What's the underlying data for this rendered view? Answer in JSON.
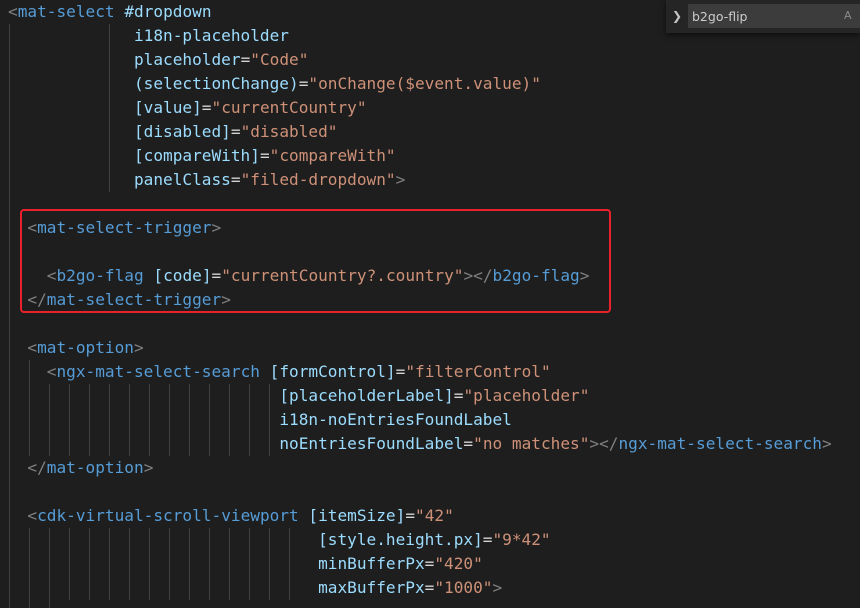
{
  "colors": {
    "background": "#1e1e1e",
    "tag": "#569cd6",
    "punctuation": "#808080",
    "attribute": "#9cdcfe",
    "string": "#ce9178",
    "text": "#d4d4d4",
    "indent_guide": "#404040",
    "highlight_border": "#e8212a"
  },
  "find_widget": {
    "toggle_icon": "chevron-right-icon",
    "value": "b2go-flip",
    "match_case_label": "A"
  },
  "lines": [
    {
      "guides": [],
      "tokens": [
        {
          "t": "<",
          "c": "punc"
        },
        {
          "t": "mat-select",
          "c": "tag"
        },
        {
          "t": " ",
          "c": "plain"
        },
        {
          "t": "#dropdown",
          "c": "attr"
        }
      ]
    },
    {
      "guides": [
        0,
        100
      ],
      "tokens": [
        {
          "t": "             ",
          "c": "plain"
        },
        {
          "t": "i18n-placeholder",
          "c": "attr"
        }
      ]
    },
    {
      "guides": [
        0,
        100
      ],
      "tokens": [
        {
          "t": "             ",
          "c": "plain"
        },
        {
          "t": "placeholder",
          "c": "attr"
        },
        {
          "t": "=",
          "c": "eq"
        },
        {
          "t": "\"Code\"",
          "c": "str"
        }
      ]
    },
    {
      "guides": [
        0,
        100
      ],
      "tokens": [
        {
          "t": "             ",
          "c": "plain"
        },
        {
          "t": "(selectionChange)",
          "c": "attr"
        },
        {
          "t": "=",
          "c": "eq"
        },
        {
          "t": "\"onChange($event.value)\"",
          "c": "str"
        }
      ]
    },
    {
      "guides": [
        0,
        100
      ],
      "tokens": [
        {
          "t": "             ",
          "c": "plain"
        },
        {
          "t": "[value]",
          "c": "attr"
        },
        {
          "t": "=",
          "c": "eq"
        },
        {
          "t": "\"currentCountry\"",
          "c": "str"
        }
      ]
    },
    {
      "guides": [
        0,
        100
      ],
      "tokens": [
        {
          "t": "             ",
          "c": "plain"
        },
        {
          "t": "[disabled]",
          "c": "attr"
        },
        {
          "t": "=",
          "c": "eq"
        },
        {
          "t": "\"disabled\"",
          "c": "str"
        }
      ]
    },
    {
      "guides": [
        0,
        100
      ],
      "tokens": [
        {
          "t": "             ",
          "c": "plain"
        },
        {
          "t": "[compareWith]",
          "c": "attr"
        },
        {
          "t": "=",
          "c": "eq"
        },
        {
          "t": "\"compareWith\"",
          "c": "str"
        }
      ]
    },
    {
      "guides": [
        0,
        100
      ],
      "tokens": [
        {
          "t": "             ",
          "c": "plain"
        },
        {
          "t": "panelClass",
          "c": "attr"
        },
        {
          "t": "=",
          "c": "eq"
        },
        {
          "t": "\"filed-dropdown\"",
          "c": "str"
        },
        {
          "t": ">",
          "c": "punc"
        }
      ]
    },
    {
      "guides": [
        0
      ],
      "tokens": []
    },
    {
      "guides": [
        0
      ],
      "tokens": [
        {
          "t": "  ",
          "c": "plain"
        },
        {
          "t": "<",
          "c": "punc"
        },
        {
          "t": "mat-select-trigger",
          "c": "tag"
        },
        {
          "t": ">",
          "c": "punc"
        }
      ]
    },
    {
      "guides": [
        0
      ],
      "tokens": []
    },
    {
      "guides": [
        0
      ],
      "tokens": [
        {
          "t": "    ",
          "c": "plain"
        },
        {
          "t": "<",
          "c": "punc"
        },
        {
          "t": "b2go-flag",
          "c": "tag"
        },
        {
          "t": " ",
          "c": "plain"
        },
        {
          "t": "[code]",
          "c": "attr"
        },
        {
          "t": "=",
          "c": "eq"
        },
        {
          "t": "\"currentCountry?.country\"",
          "c": "str"
        },
        {
          "t": "></",
          "c": "punc"
        },
        {
          "t": "b2go-flag",
          "c": "tag"
        },
        {
          "t": ">",
          "c": "punc"
        }
      ]
    },
    {
      "guides": [
        0
      ],
      "tokens": [
        {
          "t": "  ",
          "c": "plain"
        },
        {
          "t": "</",
          "c": "punc"
        },
        {
          "t": "mat-select-trigger",
          "c": "tag"
        },
        {
          "t": ">",
          "c": "punc"
        }
      ]
    },
    {
      "guides": [
        0
      ],
      "tokens": []
    },
    {
      "guides": [
        0
      ],
      "tokens": [
        {
          "t": "  ",
          "c": "plain"
        },
        {
          "t": "<",
          "c": "punc"
        },
        {
          "t": "mat-option",
          "c": "tag"
        },
        {
          "t": ">",
          "c": "punc"
        }
      ]
    },
    {
      "guides": [
        0,
        20
      ],
      "tokens": [
        {
          "t": "    ",
          "c": "plain"
        },
        {
          "t": "<",
          "c": "punc"
        },
        {
          "t": "ngx-mat-select-search",
          "c": "tag"
        },
        {
          "t": " ",
          "c": "plain"
        },
        {
          "t": "[formControl]",
          "c": "attr"
        },
        {
          "t": "=",
          "c": "eq"
        },
        {
          "t": "\"filterControl\"",
          "c": "str"
        }
      ]
    },
    {
      "guides": [
        0,
        20,
        40,
        60,
        80,
        100,
        120,
        140,
        160,
        180,
        200,
        220,
        240,
        260
      ],
      "tokens": [
        {
          "t": "                            ",
          "c": "plain"
        },
        {
          "t": "[placeholderLabel]",
          "c": "attr"
        },
        {
          "t": "=",
          "c": "eq"
        },
        {
          "t": "\"placeholder\"",
          "c": "str"
        }
      ]
    },
    {
      "guides": [
        0,
        20,
        40,
        60,
        80,
        100,
        120,
        140,
        160,
        180,
        200,
        220,
        240,
        260
      ],
      "tokens": [
        {
          "t": "                            ",
          "c": "plain"
        },
        {
          "t": "i18n-noEntriesFoundLabel",
          "c": "attr"
        }
      ]
    },
    {
      "guides": [
        0,
        20,
        40,
        60,
        80,
        100,
        120,
        140,
        160,
        180,
        200,
        220,
        240,
        260
      ],
      "tokens": [
        {
          "t": "                            ",
          "c": "plain"
        },
        {
          "t": "noEntriesFoundLabel",
          "c": "attr"
        },
        {
          "t": "=",
          "c": "eq"
        },
        {
          "t": "\"no matches\"",
          "c": "str"
        },
        {
          "t": "></",
          "c": "punc"
        },
        {
          "t": "ngx-mat-select-search",
          "c": "tag"
        },
        {
          "t": ">",
          "c": "punc"
        }
      ]
    },
    {
      "guides": [
        0
      ],
      "tokens": [
        {
          "t": "  ",
          "c": "plain"
        },
        {
          "t": "</",
          "c": "punc"
        },
        {
          "t": "mat-option",
          "c": "tag"
        },
        {
          "t": ">",
          "c": "punc"
        }
      ]
    },
    {
      "guides": [
        0
      ],
      "tokens": []
    },
    {
      "guides": [
        0
      ],
      "tokens": [
        {
          "t": "  ",
          "c": "plain"
        },
        {
          "t": "<",
          "c": "punc"
        },
        {
          "t": "cdk-virtual-scroll-viewport",
          "c": "tag"
        },
        {
          "t": " ",
          "c": "plain"
        },
        {
          "t": "[itemSize]",
          "c": "attr"
        },
        {
          "t": "=",
          "c": "eq"
        },
        {
          "t": "\"42\"",
          "c": "str"
        }
      ]
    },
    {
      "guides": [
        0,
        20,
        40,
        60,
        80,
        100,
        120,
        140,
        160,
        180,
        200,
        220,
        240,
        260,
        280
      ],
      "tokens": [
        {
          "t": "                                ",
          "c": "plain"
        },
        {
          "t": "[style.height.px]",
          "c": "attr"
        },
        {
          "t": "=",
          "c": "eq"
        },
        {
          "t": "\"9*42\"",
          "c": "str"
        }
      ]
    },
    {
      "guides": [
        0,
        20,
        40,
        60,
        80,
        100,
        120,
        140,
        160,
        180,
        200,
        220,
        240,
        260,
        280
      ],
      "tokens": [
        {
          "t": "                                ",
          "c": "plain"
        },
        {
          "t": "minBufferPx",
          "c": "attr"
        },
        {
          "t": "=",
          "c": "eq"
        },
        {
          "t": "\"420\"",
          "c": "str"
        }
      ]
    },
    {
      "guides": [
        0,
        20,
        40,
        60,
        80,
        100,
        120,
        140,
        160,
        180,
        200,
        220,
        240,
        260,
        280
      ],
      "tokens": [
        {
          "t": "                                ",
          "c": "plain"
        },
        {
          "t": "maxBufferPx",
          "c": "attr"
        },
        {
          "t": "=",
          "c": "eq"
        },
        {
          "t": "\"1000\"",
          "c": "str"
        },
        {
          "t": ">",
          "c": "punc"
        }
      ]
    },
    {
      "guides": [
        0,
        20,
        40
      ],
      "tokens": []
    }
  ]
}
